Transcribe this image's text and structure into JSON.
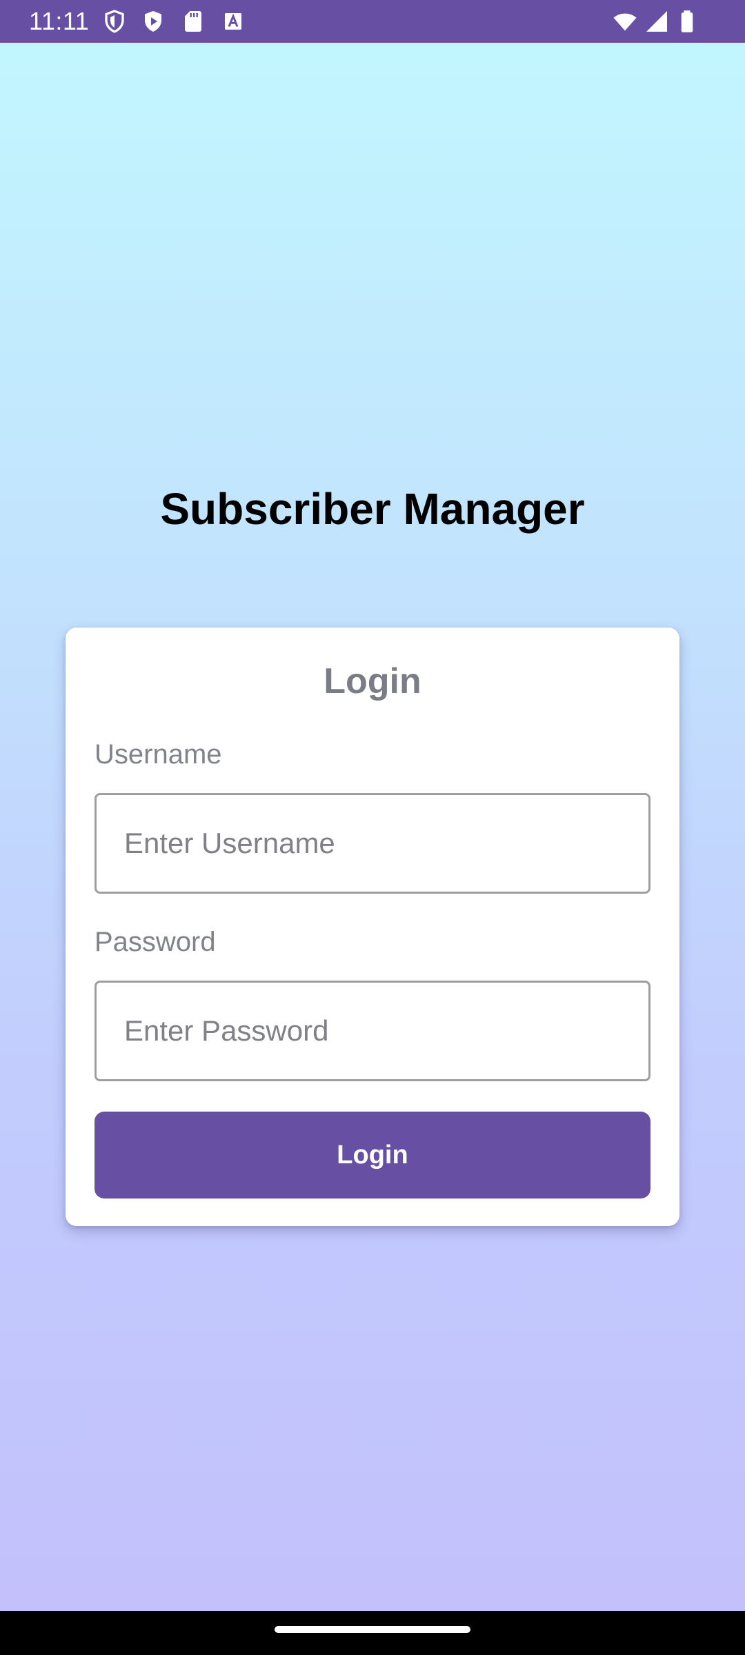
{
  "status_bar": {
    "time": "11:11",
    "left_icons": [
      "shield-icon",
      "play-protect-icon",
      "sd-card-icon",
      "keyboard-a-icon"
    ],
    "right_icons": [
      "wifi-icon",
      "cell-signal-icon",
      "battery-icon"
    ],
    "background_color": "#6750a4"
  },
  "app": {
    "title": "Subscriber Manager"
  },
  "login_card": {
    "title": "Login",
    "username_label": "Username",
    "username_placeholder": "Enter Username",
    "username_value": "",
    "password_label": "Password",
    "password_placeholder": "Enter Password",
    "password_value": "",
    "button_label": "Login"
  },
  "colors": {
    "accent": "#6750a4",
    "gradient_top": "#c2f6ff",
    "gradient_bottom": "#c3c0fc"
  }
}
